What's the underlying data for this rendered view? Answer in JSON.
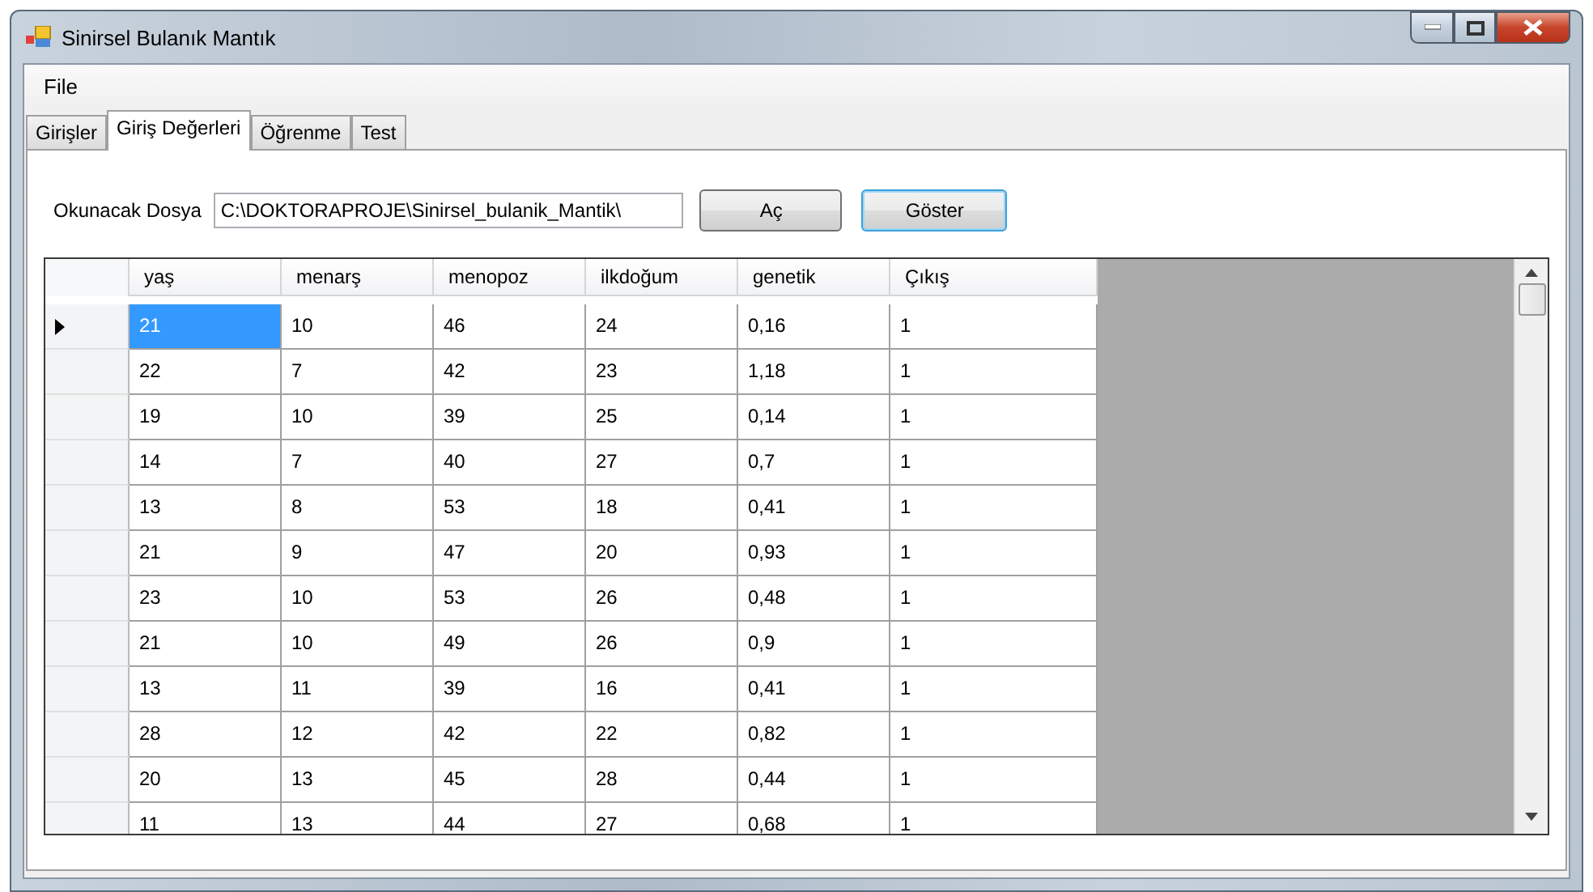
{
  "window": {
    "title": "Sinirsel Bulanık Mantık"
  },
  "menu": [
    "File"
  ],
  "tabs": [
    {
      "label": "Girişler",
      "selected": false
    },
    {
      "label": "Giriş Değerleri",
      "selected": true
    },
    {
      "label": "Öğrenme",
      "selected": false
    },
    {
      "label": "Test",
      "selected": false
    }
  ],
  "file_field": {
    "label": "Okunacak Dosya",
    "value": "C:\\DOKTORAPROJE\\Sinirsel_bulanik_Mantik\\"
  },
  "buttons": [
    {
      "label": "Aç",
      "focused": false
    },
    {
      "label": "Göster",
      "focused": true
    }
  ],
  "table": {
    "columns": [
      "yaş",
      "menarş",
      "menopoz",
      "ilkdoğum",
      "genetik",
      "Çıkış"
    ],
    "rows": [
      {
        "selected": true,
        "cells": [
          "21",
          "10",
          "46",
          "24",
          "0,16",
          "1"
        ]
      },
      {
        "selected": false,
        "cells": [
          "22",
          "7",
          "42",
          "23",
          "1,18",
          "1"
        ]
      },
      {
        "selected": false,
        "cells": [
          "19",
          "10",
          "39",
          "25",
          "0,14",
          "1"
        ]
      },
      {
        "selected": false,
        "cells": [
          "14",
          "7",
          "40",
          "27",
          "0,7",
          "1"
        ]
      },
      {
        "selected": false,
        "cells": [
          "13",
          "8",
          "53",
          "18",
          "0,41",
          "1"
        ]
      },
      {
        "selected": false,
        "cells": [
          "21",
          "9",
          "47",
          "20",
          "0,93",
          "1"
        ]
      },
      {
        "selected": false,
        "cells": [
          "23",
          "10",
          "53",
          "26",
          "0,48",
          "1"
        ]
      },
      {
        "selected": false,
        "cells": [
          "21",
          "10",
          "49",
          "26",
          "0,9",
          "1"
        ]
      },
      {
        "selected": false,
        "cells": [
          "13",
          "11",
          "39",
          "16",
          "0,41",
          "1"
        ]
      },
      {
        "selected": false,
        "cells": [
          "28",
          "12",
          "42",
          "22",
          "0,82",
          "1"
        ]
      },
      {
        "selected": false,
        "cells": [
          "20",
          "13",
          "45",
          "28",
          "0,44",
          "1"
        ]
      },
      {
        "selected": false,
        "cells": [
          "11",
          "13",
          "44",
          "27",
          "0,68",
          "1"
        ]
      }
    ]
  }
}
